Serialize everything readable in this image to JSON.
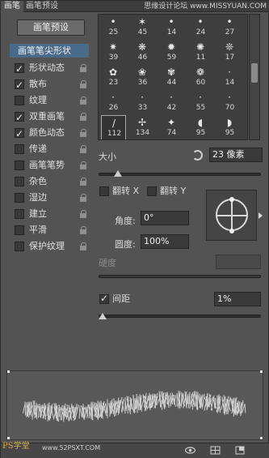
{
  "tabs": [
    "画笔",
    "画笔预设"
  ],
  "watermark": "思缘设计论坛 www.MISSYUAN.COM",
  "preset_button": "画笔预设",
  "tip_shape": "画笔笔尖形状",
  "options": [
    {
      "label": "形状动态",
      "checked": true
    },
    {
      "label": "散布",
      "checked": true
    },
    {
      "label": "纹理",
      "checked": false
    },
    {
      "label": "双重画笔",
      "checked": true
    },
    {
      "label": "颜色动态",
      "checked": true
    },
    {
      "label": "传递",
      "checked": false
    },
    {
      "label": "画笔笔势",
      "checked": false
    },
    {
      "label": "杂色",
      "checked": false
    },
    {
      "label": "湿边",
      "checked": false
    },
    {
      "label": "建立",
      "checked": false
    },
    {
      "label": "平滑",
      "checked": false
    },
    {
      "label": "保护纹理",
      "checked": false
    }
  ],
  "brush_sizes": [
    "25",
    "45",
    "14",
    "24",
    "27",
    "39",
    "46",
    "59",
    "11",
    "17",
    "23",
    "36",
    "44",
    "60",
    "14",
    "26",
    "33",
    "42",
    "55",
    "70",
    "112",
    "134",
    "74",
    "95",
    "95"
  ],
  "brush_selected": "112",
  "size_label": "大小",
  "size_value": "23 像素",
  "size_slider_pct": 0.12,
  "flip_x": "翻转 X",
  "flip_y": "翻转 Y",
  "angle_label": "角度:",
  "angle_value": "0°",
  "roundness_label": "圆度:",
  "roundness_value": "100%",
  "hardness_label": "硬度",
  "spacing_label": "间距",
  "spacing_checked": true,
  "spacing_value": "1%",
  "spacing_slider_pct": 0.0,
  "footer_logo": "PS学堂",
  "footer_url": "www.52PSXT.COM"
}
